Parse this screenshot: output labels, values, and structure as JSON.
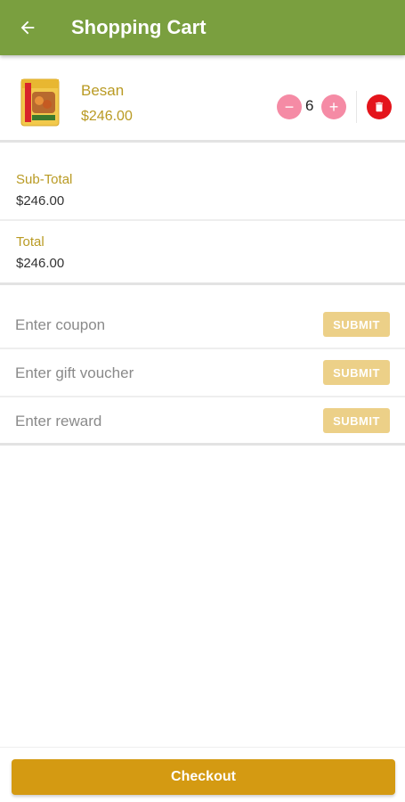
{
  "header": {
    "title": "Shopping Cart",
    "back_icon": "arrow-left-icon",
    "background": "#7a9f3f"
  },
  "cart": {
    "items": [
      {
        "name": "Besan",
        "price": "$246.00",
        "quantity": "6",
        "thumbnail_icon": "product-package-icon",
        "minus_label": "−",
        "plus_label": "+",
        "delete_icon": "trash-icon"
      }
    ]
  },
  "totals": {
    "subtotal_label": "Sub-Total",
    "subtotal_value": "$246.00",
    "total_label": "Total",
    "total_value": "$246.00"
  },
  "codes": {
    "coupon_placeholder": "Enter coupon",
    "gift_placeholder": "Enter gift voucher",
    "reward_placeholder": "Enter reward",
    "submit_label": "SUBMIT"
  },
  "footer": {
    "checkout_label": "Checkout"
  },
  "colors": {
    "accent_text": "#b99a23",
    "qty_button": "#f58ba5",
    "delete_button": "#e4141b",
    "submit_button": "#ecd088",
    "checkout_button": "#d49a12"
  }
}
